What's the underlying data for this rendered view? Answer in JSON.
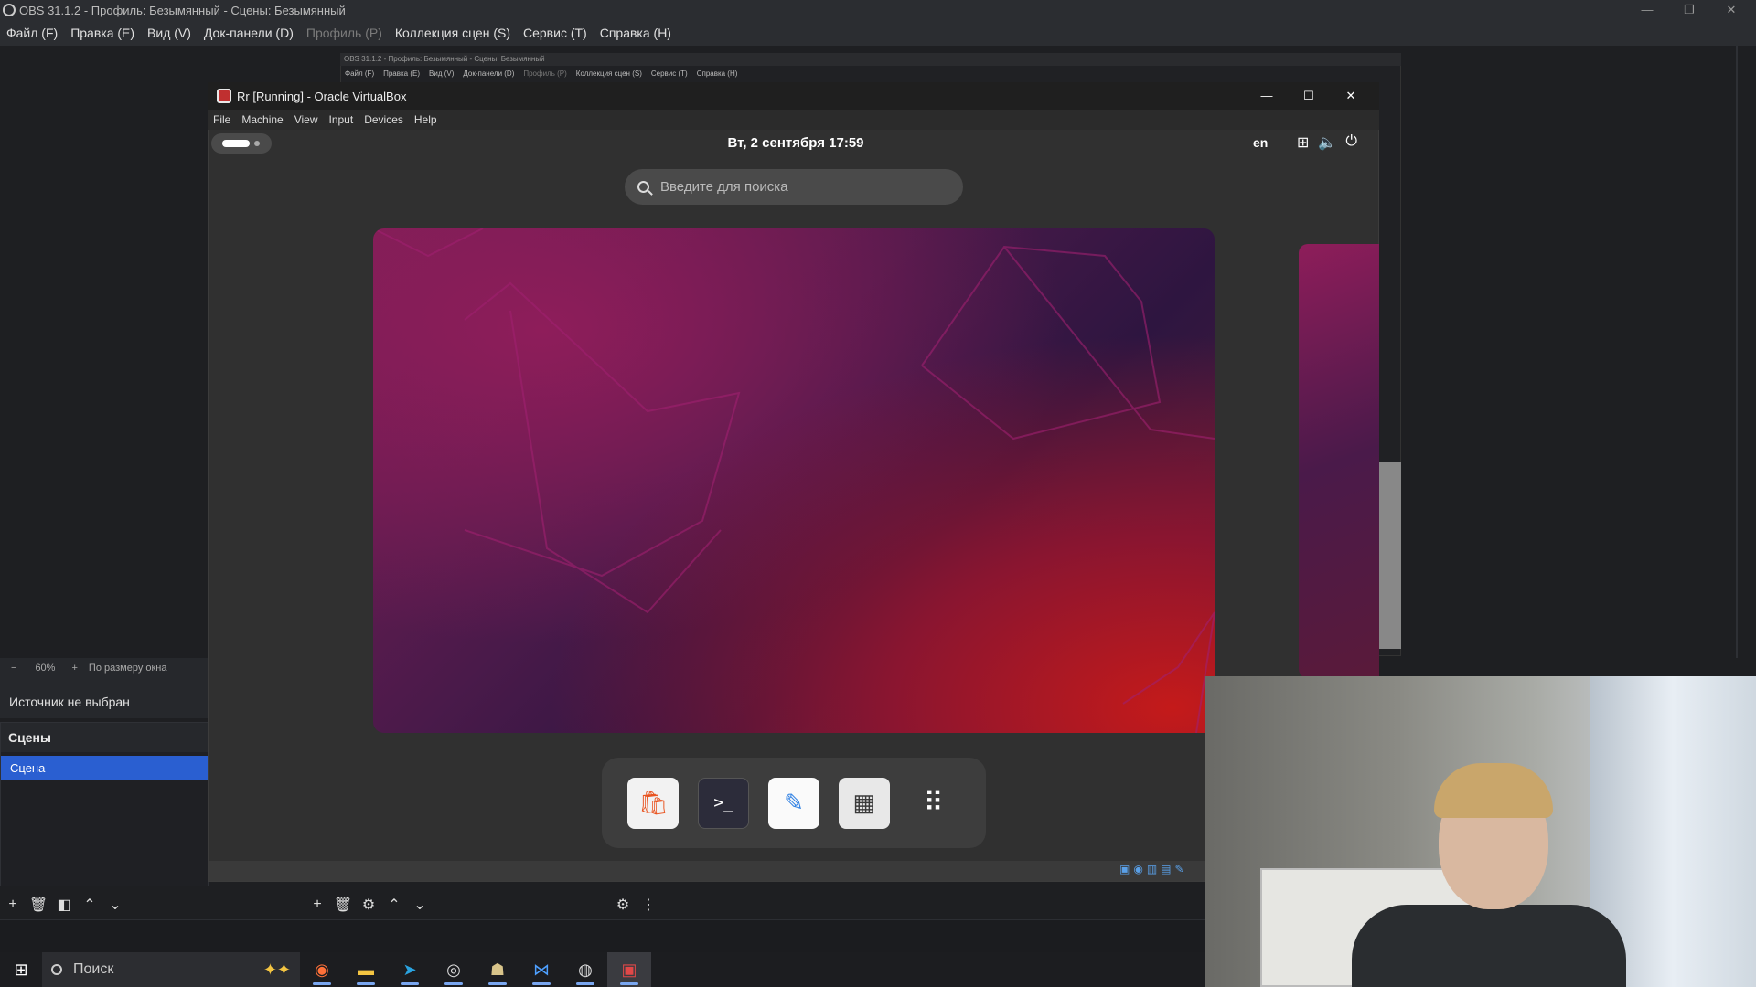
{
  "obs": {
    "title": "OBS 31.1.2 - Профиль: Безымянный - Сцены: Безымянный",
    "menu": [
      {
        "label": "Файл (F)",
        "disabled": false
      },
      {
        "label": "Правка (E)",
        "disabled": false
      },
      {
        "label": "Вид (V)",
        "disabled": false
      },
      {
        "label": "Док-панели (D)",
        "disabled": false
      },
      {
        "label": "Профиль (P)",
        "disabled": true
      },
      {
        "label": "Коллекция сцен (S)",
        "disabled": false
      },
      {
        "label": "Сервис (T)",
        "disabled": false
      },
      {
        "label": "Справка (H)",
        "disabled": false
      }
    ],
    "zoom": {
      "minus": "−",
      "value": "60%",
      "plus": "+",
      "fit": "По размеру окна"
    },
    "source_status": "Источник не выбран",
    "scenes": {
      "header": "Сцены",
      "items": [
        "Сцена"
      ]
    },
    "nested_title": "OBS 31.1.2 - Профиль: Безымянный - Сцены: Безымянный",
    "nested_menu": [
      "Файл (F)",
      "Правка (E)",
      "Вид (V)",
      "Док-панели (D)",
      "Профиль (P)",
      "Коллекция сцен (S)",
      "Сервис (T)",
      "Справка (H)"
    ]
  },
  "vbox": {
    "title": "Rr [Running] - Oracle VirtualBox",
    "menu": [
      "File",
      "Machine",
      "View",
      "Input",
      "Devices",
      "Help"
    ]
  },
  "ubuntu": {
    "clock": "Вт, 2 сентября  17:59",
    "lang": "en",
    "search_placeholder": "Введите для поиска",
    "dock": [
      {
        "name": "app-center",
        "glyph": "🛍"
      },
      {
        "name": "terminal",
        "glyph": ">_"
      },
      {
        "name": "text-editor",
        "glyph": "✎"
      },
      {
        "name": "calculator",
        "glyph": "▦"
      },
      {
        "name": "show-apps",
        "glyph": "⠿"
      }
    ]
  },
  "taskbar": {
    "search_label": "Поиск",
    "apps": [
      "firefox",
      "file-explorer",
      "telegram",
      "obs",
      "app",
      "visual-studio",
      "webcam",
      "virtualbox"
    ]
  }
}
